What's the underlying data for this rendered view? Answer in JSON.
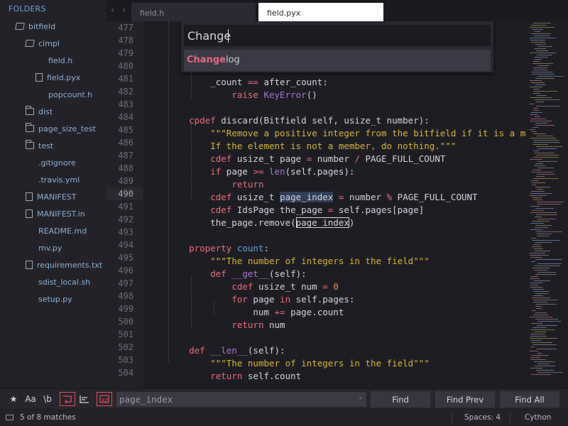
{
  "sidebar": {
    "header": "FOLDERS",
    "items": [
      {
        "label": "bitfield",
        "type": "folder-open",
        "depth": 0
      },
      {
        "label": "cimpl",
        "type": "folder-open",
        "depth": 1
      },
      {
        "label": "field.h",
        "type": "file-plain",
        "depth": 2
      },
      {
        "label": "field.pyx",
        "type": "file",
        "depth": 2
      },
      {
        "label": "popcount.h",
        "type": "file-plain",
        "depth": 2
      },
      {
        "label": "dist",
        "type": "folder",
        "depth": 1
      },
      {
        "label": "page_size_test",
        "type": "folder",
        "depth": 1
      },
      {
        "label": "test",
        "type": "folder",
        "depth": 1
      },
      {
        "label": ".gitignore",
        "type": "file-plain",
        "depth": 1
      },
      {
        "label": ".travis.yml",
        "type": "file-plain",
        "depth": 1
      },
      {
        "label": "MANIFEST",
        "type": "file",
        "depth": 1
      },
      {
        "label": "MANIFEST.in",
        "type": "file",
        "depth": 1
      },
      {
        "label": "README.md",
        "type": "file-plain",
        "depth": 1
      },
      {
        "label": "mv.py",
        "type": "file-plain",
        "depth": 1
      },
      {
        "label": "requirements.txt",
        "type": "file",
        "depth": 1
      },
      {
        "label": "sdist_local.sh",
        "type": "file-plain",
        "depth": 1
      },
      {
        "label": "setup.py",
        "type": "file-plain",
        "depth": 1
      }
    ]
  },
  "tabs": [
    {
      "label": "field.h",
      "active": false
    },
    {
      "label": "field.pyx",
      "active": true
    }
  ],
  "palette": {
    "query": "Change",
    "result_match": "Change",
    "result_rest": "log"
  },
  "line_numbers": [
    "477",
    "478",
    "479",
    "480",
    "481",
    "482",
    "483",
    "484",
    "485",
    "486",
    "487",
    "488",
    "489",
    "490",
    "491",
    "492",
    "493",
    "494",
    "495",
    "496",
    "497",
    "498",
    "499",
    "500",
    "501",
    "502",
    "503",
    "504"
  ],
  "current_line": "490",
  "find": {
    "value": "page_index",
    "find_label": "Find",
    "find_prev_label": "Find Prev",
    "find_all_label": "Find All",
    "toggle_regex": "★",
    "toggle_case": "Aa",
    "toggle_word": "\\b"
  },
  "status": {
    "matches": "5 of 8 matches",
    "spaces": "Spaces: 4",
    "syntax": "Cython"
  },
  "colors": {
    "accent": "#6aa2d4",
    "keyword": "#ef6c7a",
    "string": "#d7b634",
    "number": "#e48f4a",
    "function": "#a874d6",
    "background": "#1e1d24"
  }
}
